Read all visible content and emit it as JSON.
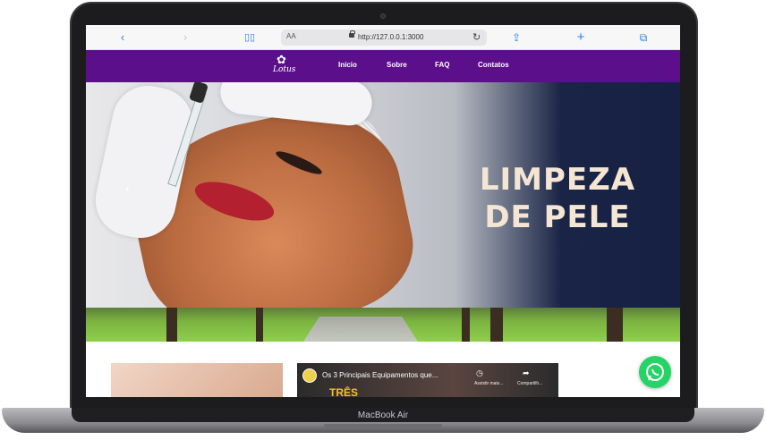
{
  "device": {
    "label": "MacBook Air"
  },
  "browser": {
    "text_size_label": "AA",
    "url": "http://127.0.0.1:3000",
    "icons": [
      "back-icon",
      "forward-icon",
      "bookmarks-icon",
      "reload-icon",
      "share-icon",
      "new-tab-icon",
      "tabs-icon"
    ]
  },
  "site": {
    "logo_text": "Lotus",
    "nav": [
      "Início",
      "Sobre",
      "FAQ",
      "Contatos"
    ],
    "nav_color": "#5c0f8b"
  },
  "hero": {
    "headline_line1": "LIMPEZA",
    "headline_line2": "DE PELE"
  },
  "video": {
    "title": "Os 3 Principais Equipamentos que...",
    "watch_later": "Assistir mais...",
    "share": "Compartilh...",
    "overlay_text": "TRÊS"
  },
  "whatsapp": {
    "color": "#25d366"
  }
}
